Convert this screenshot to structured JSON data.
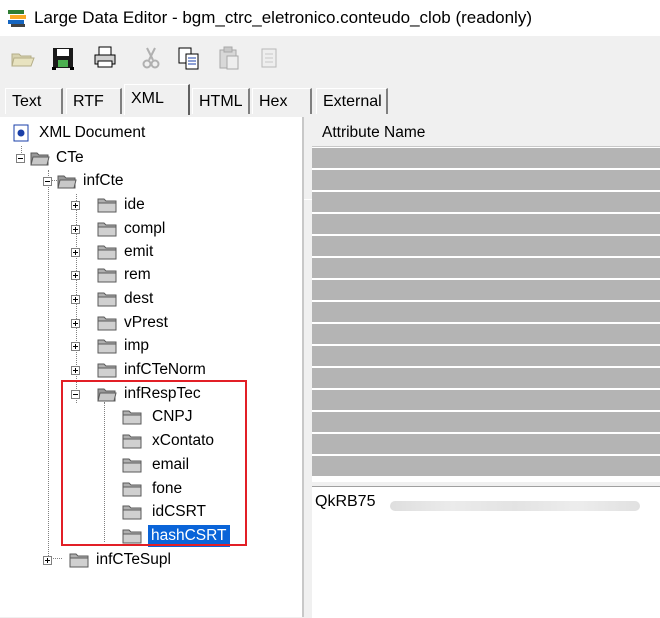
{
  "window": {
    "title": "Large Data Editor - bgm_ctrc_eletronico.conteudo_clob (readonly)",
    "icon": "stack-app-icon"
  },
  "toolbar": {
    "buttons": [
      {
        "name": "open-folder-icon",
        "enabled": false
      },
      {
        "name": "save-disk-icon",
        "enabled": true
      },
      {
        "name": "print-icon",
        "enabled": true
      },
      {
        "name": "cut-scissors-icon",
        "enabled": false
      },
      {
        "name": "copy-icon",
        "enabled": true
      },
      {
        "name": "paste-icon",
        "enabled": false
      },
      {
        "name": "clear-icon",
        "enabled": false
      }
    ]
  },
  "tabs": [
    {
      "label": "Text",
      "active": false
    },
    {
      "label": "RTF",
      "active": false
    },
    {
      "label": "XML",
      "active": true
    },
    {
      "label": "HTML",
      "active": false
    },
    {
      "label": "Hex",
      "active": false
    },
    {
      "label": "External",
      "active": false
    }
  ],
  "tree": {
    "root": "XML Document",
    "cte": "CTe",
    "infcte": "infCte",
    "children": [
      "ide",
      "compl",
      "emit",
      "rem",
      "dest",
      "vPrest",
      "imp",
      "infCTeNorm"
    ],
    "infresptec": "infRespTec",
    "infresptec_children": [
      "CNPJ",
      "xContato",
      "email",
      "fone",
      "idCSRT",
      "hashCSRT"
    ],
    "selected": "hashCSRT",
    "sibling": "infCTeSupl"
  },
  "attributes": {
    "column_header": "Attribute Name"
  },
  "value": {
    "visible_text": "QkRB75",
    "obscured": true
  },
  "colors": {
    "selection": "#0a64d8",
    "highlight_border": "#e21f26",
    "grid_row": "#b4b4b4"
  }
}
